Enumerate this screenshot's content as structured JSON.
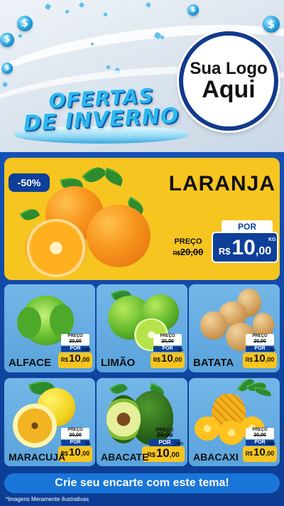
{
  "header": {
    "logo_line1": "Sua Logo",
    "logo_line2": "Aqui",
    "title_line1": "OFERTAS",
    "title_line2": "DE INVERNO",
    "coin_symbol": "$"
  },
  "hero": {
    "discount": "-50%",
    "name": "LARANJA",
    "preco_label": "PREÇO",
    "old_currency": "R$",
    "old_price": "20,00",
    "por_label": "POR",
    "currency": "R$",
    "price_int": "10",
    "price_cents": ",00",
    "unit": "KG"
  },
  "products": [
    {
      "name": "ALFACE",
      "preco_label": "PREÇO",
      "old_price": "20,00",
      "por_label": "POR",
      "currency": "R$",
      "price_int": "10",
      "price_cents": ",00",
      "unit": "UNID"
    },
    {
      "name": "LIMÃO",
      "preco_label": "PREÇO",
      "old_price": "20,00",
      "por_label": "POR",
      "currency": "R$",
      "price_int": "10",
      "price_cents": ",00",
      "unit": "KG"
    },
    {
      "name": "BATATA",
      "preco_label": "PREÇO",
      "old_price": "20,00",
      "por_label": "POR",
      "currency": "R$",
      "price_int": "10",
      "price_cents": ",00",
      "unit": "KG"
    },
    {
      "name": "MARACUJÁ",
      "preco_label": "PREÇO",
      "old_price": "20,00",
      "por_label": "POR",
      "currency": "R$",
      "price_int": "10",
      "price_cents": ",00",
      "unit": "KG"
    },
    {
      "name": "ABACATE",
      "preco_label": "PREÇO",
      "old_price": "20,00",
      "por_label": "POR",
      "currency": "R$",
      "price_int": "10",
      "price_cents": ",00",
      "unit": "UNID"
    },
    {
      "name": "ABACAXI",
      "preco_label": "PREÇO",
      "old_price": "20,00",
      "por_label": "POR",
      "currency": "R$",
      "price_int": "10",
      "price_cents": ",00",
      "unit": "UNID"
    }
  ],
  "footer": {
    "cta": "Crie seu encarte com este tema!",
    "note": "*Imagens Meramente Ilustrativas"
  },
  "colors": {
    "brand_blue": "#0e3f99",
    "accent_yellow": "#f7c520",
    "card_blue": "#6aaee3",
    "cta_blue": "#1976d8"
  }
}
